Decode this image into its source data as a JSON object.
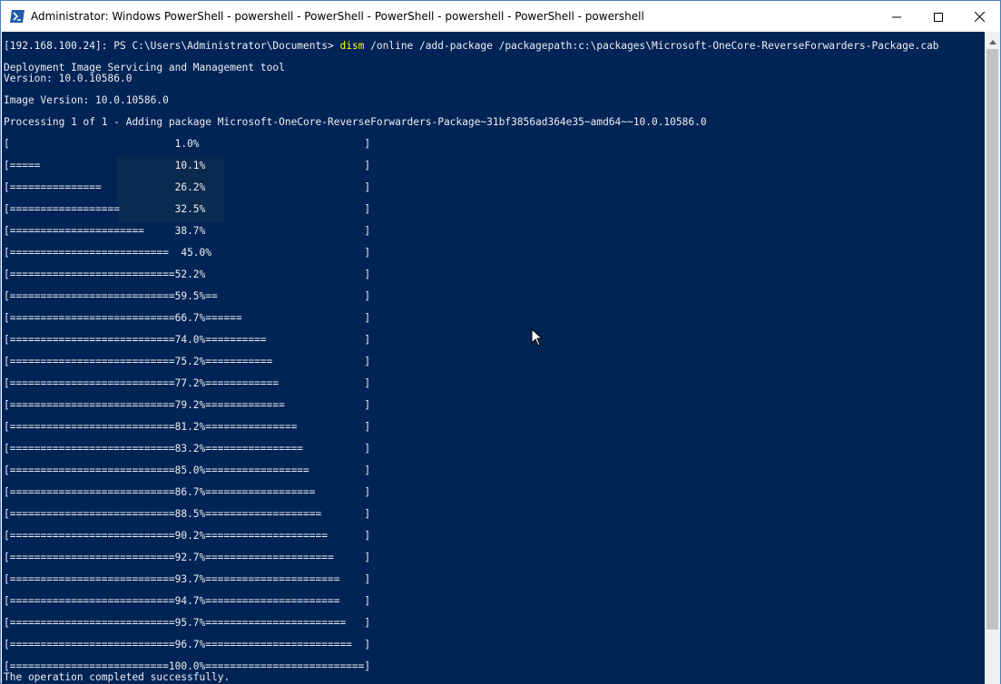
{
  "window": {
    "title": "Administrator: Windows PowerShell - powershell - PowerShell - PowerShell - powershell - PowerShell - powershell",
    "icon": "powershell-icon",
    "controls": [
      "minimize-icon",
      "maximize-icon",
      "close-icon"
    ]
  },
  "colors": {
    "console_bg": "#012456",
    "console_fg": "#eeedf0",
    "command_fg": "#ffff00",
    "titlebar_bg": "#ffffff"
  },
  "console": {
    "prompt": "[192.168.100.24]: PS C:\\Users\\Administrator\\Documents> ",
    "command_name": "dism",
    "command_args": " /online /add-package /packagepath:c:\\packages\\Microsoft-OneCore-ReverseForwarders-Package.cab",
    "lines": [
      "",
      "Deployment Image Servicing and Management tool",
      "Version: 10.0.10586.0",
      "",
      "Image Version: 10.0.10586.0",
      "",
      "Processing 1 of 1 - Adding package Microsoft-OneCore-ReverseForwarders-Package~31bf3856ad364e35~amd64~~10.0.10586.0",
      "",
      "[                           1.0%                           ]",
      "",
      "[=====                      10.1%                          ]",
      "",
      "[===============            26.2%                          ]",
      "",
      "[==================         32.5%                          ]",
      "",
      "[======================     38.7%                          ]",
      "",
      "[==========================  45.0%                         ]",
      "",
      "[===========================52.2%                          ]",
      "",
      "[===========================59.5%==                        ]",
      "",
      "[===========================66.7%======                    ]",
      "",
      "[===========================74.0%==========                ]",
      "",
      "[===========================75.2%===========               ]",
      "",
      "[===========================77.2%============              ]",
      "",
      "[===========================79.2%=============             ]",
      "",
      "[===========================81.2%===============           ]",
      "",
      "[===========================83.2%================          ]",
      "",
      "[===========================85.0%=================         ]",
      "",
      "[===========================86.7%==================        ]",
      "",
      "[===========================88.5%===================       ]",
      "",
      "[===========================90.2%====================      ]",
      "",
      "[===========================92.7%=====================     ]",
      "",
      "[===========================93.7%======================    ]",
      "",
      "[===========================94.7%======================    ]",
      "",
      "[===========================95.7%=======================   ]",
      "",
      "[===========================96.7%========================  ]",
      "",
      "[==========================100.0%==========================]",
      "The operation completed successfully."
    ]
  }
}
